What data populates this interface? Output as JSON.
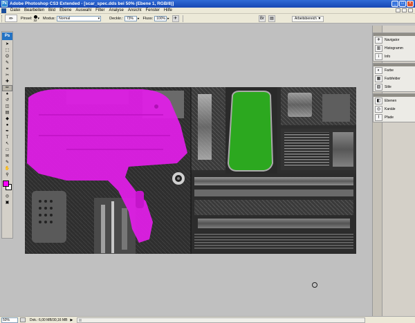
{
  "window": {
    "title": "Adobe Photoshop CS3 Extended - [scar_spec.dds bei 50% (Ebene 1, RGB/8)]",
    "app_icon": "Ps",
    "minimize": "_",
    "maximize": "□",
    "close": "×"
  },
  "menu": [
    "Datei",
    "Bearbeiten",
    "Bild",
    "Ebene",
    "Auswahl",
    "Filter",
    "Analyse",
    "Ansicht",
    "Fenster",
    "Hilfe"
  ],
  "options": {
    "brush_label": "Pinsel:",
    "brush_size": "32",
    "mode_label": "Modus:",
    "mode_value": "Normal",
    "opacity_label": "Deckkr.:",
    "opacity_value": "73%",
    "flow_label": "Fluss:",
    "flow_value": "100%",
    "workspace_label": "Arbeitsbereich ▼"
  },
  "toolbox": {
    "logo": "Ps",
    "tools": [
      {
        "name": "move-tool",
        "glyph": "➤"
      },
      {
        "name": "marquee-tool",
        "glyph": "⬚"
      },
      {
        "name": "lasso-tool",
        "glyph": "ʘ"
      },
      {
        "name": "quick-select-tool",
        "glyph": "✎"
      },
      {
        "name": "crop-tool",
        "glyph": "⌗"
      },
      {
        "name": "slice-tool",
        "glyph": "✂"
      },
      {
        "name": "healing-tool",
        "glyph": "✚"
      },
      {
        "name": "brush-tool",
        "glyph": "✏"
      },
      {
        "name": "clone-stamp-tool",
        "glyph": "♠"
      },
      {
        "name": "history-brush-tool",
        "glyph": "↺"
      },
      {
        "name": "eraser-tool",
        "glyph": "◫"
      },
      {
        "name": "gradient-tool",
        "glyph": "▤"
      },
      {
        "name": "blur-tool",
        "glyph": "◆"
      },
      {
        "name": "dodge-tool",
        "glyph": "●"
      },
      {
        "name": "pen-tool",
        "glyph": "✒"
      },
      {
        "name": "type-tool",
        "glyph": "T"
      },
      {
        "name": "path-select-tool",
        "glyph": "↖"
      },
      {
        "name": "shape-tool",
        "glyph": "□"
      },
      {
        "name": "notes-tool",
        "glyph": "✉"
      },
      {
        "name": "eyedropper-tool",
        "glyph": "✎"
      },
      {
        "name": "hand-tool",
        "glyph": "✋"
      },
      {
        "name": "zoom-tool",
        "glyph": "⚲"
      }
    ],
    "active_tool": 7,
    "fg_color": "#ff00ff",
    "bg_color": "#ffffff"
  },
  "panels": [
    {
      "items": [
        {
          "icon": "navigator-icon",
          "label": "Navigator",
          "glyph": "✈"
        },
        {
          "icon": "histogram-icon",
          "label": "Histogramm",
          "glyph": "▥"
        },
        {
          "icon": "info-icon",
          "label": "Info",
          "glyph": "i"
        }
      ]
    },
    {
      "items": [
        {
          "icon": "color-icon",
          "label": "Farbe",
          "glyph": "◐"
        },
        {
          "icon": "swatches-icon",
          "label": "Farbfelder",
          "glyph": "▦"
        },
        {
          "icon": "styles-icon",
          "label": "Stile",
          "glyph": "▧"
        }
      ]
    },
    {
      "items": [
        {
          "icon": "layers-icon",
          "label": "Ebenen",
          "glyph": "◧"
        },
        {
          "icon": "channels-icon",
          "label": "Kanäle",
          "glyph": "◎"
        },
        {
          "icon": "paths-icon",
          "label": "Pfade",
          "glyph": "⌇"
        }
      ]
    }
  ],
  "status": {
    "zoom": "50%",
    "doc_size": "Dok.: 6,00 MB/30,16 MB",
    "arrow": "▶"
  },
  "colors": {
    "magenta_overlay": "#e21ee8",
    "green_overlay": "#2ca81f"
  }
}
